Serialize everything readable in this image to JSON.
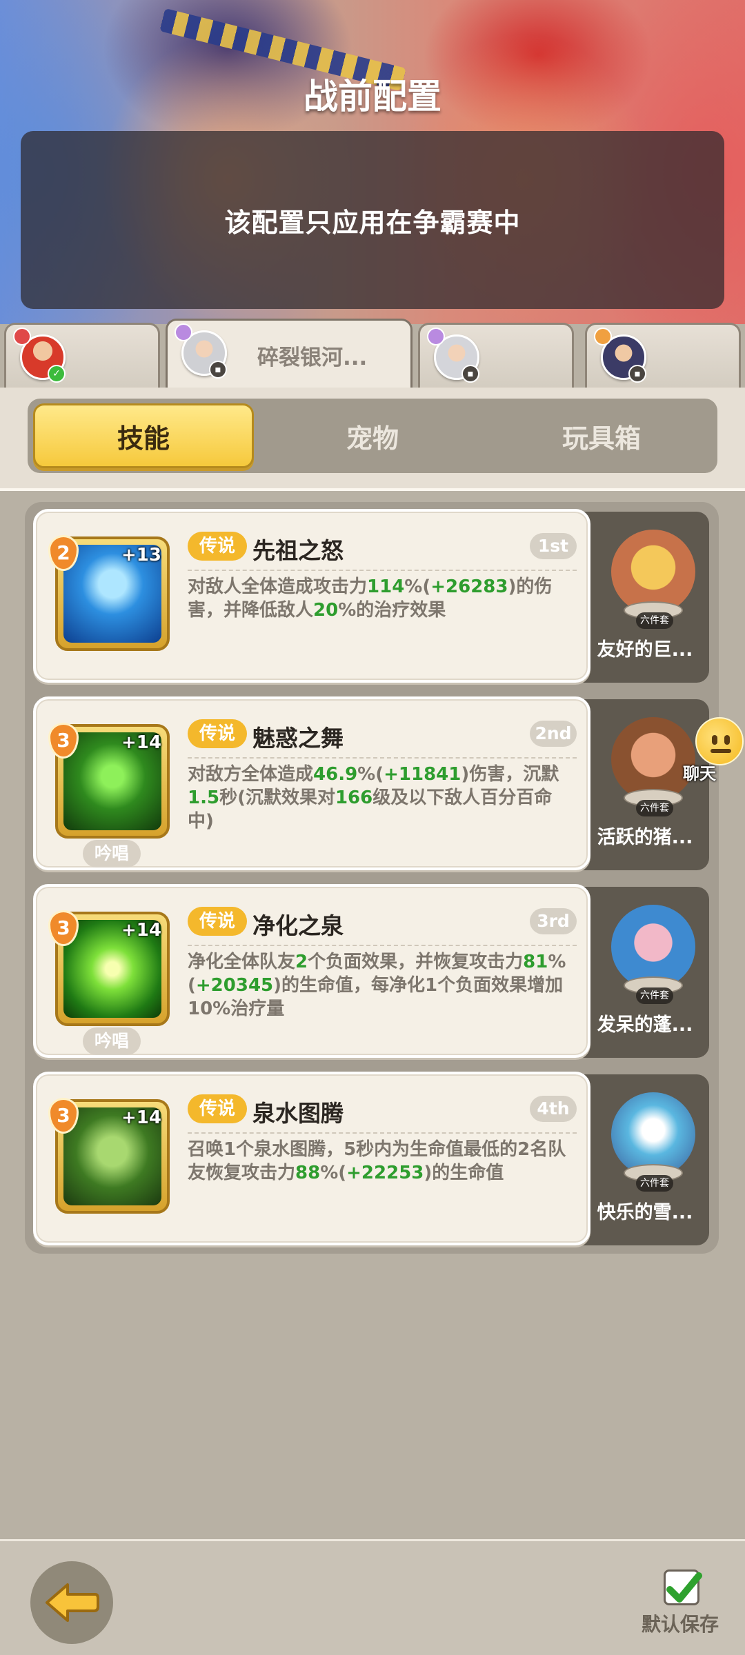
{
  "header": {
    "title": "战前配置",
    "notice": "该配置只应用在争霸赛中"
  },
  "hero_tabs": [
    {
      "name": "",
      "active": false
    },
    {
      "name": "碎裂银河...",
      "active": true
    },
    {
      "name": "",
      "active": false
    },
    {
      "name": "",
      "active": false
    }
  ],
  "tabs": {
    "skills": "技能",
    "pets": "宠物",
    "toybox": "玩具箱"
  },
  "skills": [
    {
      "level": "2",
      "plus": "+13",
      "rarity": "传说",
      "name": "先祖之怒",
      "rank": "1st",
      "desc": [
        {
          "t": "对敌人全体造成攻击力",
          "g": false
        },
        {
          "t": "114",
          "g": true
        },
        {
          "t": "%(",
          "g": false
        },
        {
          "t": "+26283",
          "g": true
        },
        {
          "t": ")的伤害，并降低敌人",
          "g": false
        },
        {
          "t": "20",
          "g": true
        },
        {
          "t": "%的治疗效果",
          "g": false
        }
      ],
      "chant": "",
      "pet_name": "友好的巨...",
      "pet_tag": "六件套"
    },
    {
      "level": "3",
      "plus": "+14",
      "rarity": "传说",
      "name": "魅惑之舞",
      "rank": "2nd",
      "desc": [
        {
          "t": "对敌方全体造成",
          "g": false
        },
        {
          "t": "46.9",
          "g": true
        },
        {
          "t": "%(",
          "g": false
        },
        {
          "t": "+11841",
          "g": true
        },
        {
          "t": ")伤害，沉默",
          "g": false
        },
        {
          "t": "1.5",
          "g": true
        },
        {
          "t": "秒(沉默效果对",
          "g": false
        },
        {
          "t": "166",
          "g": true
        },
        {
          "t": "级及以下敌人百分百命中)",
          "g": false
        }
      ],
      "chant": "吟唱",
      "pet_name": "活跃的猪...",
      "pet_tag": "六件套"
    },
    {
      "level": "3",
      "plus": "+14",
      "rarity": "传说",
      "name": "净化之泉",
      "rank": "3rd",
      "desc": [
        {
          "t": "净化全体队友",
          "g": false
        },
        {
          "t": "2",
          "g": true
        },
        {
          "t": "个负面效果，并恢复攻击力",
          "g": false
        },
        {
          "t": "81",
          "g": true
        },
        {
          "t": "%(",
          "g": false
        },
        {
          "t": "+20345",
          "g": true
        },
        {
          "t": ")的生命值，每净化1个负面效果增加10%治疗量",
          "g": false
        }
      ],
      "chant": "吟唱",
      "pet_name": "发呆的蓬...",
      "pet_tag": "六件套"
    },
    {
      "level": "3",
      "plus": "+14",
      "rarity": "传说",
      "name": "泉水图腾",
      "rank": "4th",
      "desc": [
        {
          "t": "召唤1个泉水图腾，5秒内为生命值最低的2名队友恢复攻击力",
          "g": false
        },
        {
          "t": "88",
          "g": true
        },
        {
          "t": "%(",
          "g": false
        },
        {
          "t": "+22253",
          "g": true
        },
        {
          "t": ")的生命值",
          "g": false
        }
      ],
      "chant": "",
      "pet_name": "快乐的雪...",
      "pet_tag": "六件套"
    }
  ],
  "chat": {
    "label": "聊天"
  },
  "footer": {
    "save_label": "默认保存"
  },
  "colors": {
    "accent_yellow": "#f6c93c",
    "rarity_gold": "#f4b82c",
    "value_green": "#2e9d2e",
    "panel_bg": "#b8b1a4"
  }
}
